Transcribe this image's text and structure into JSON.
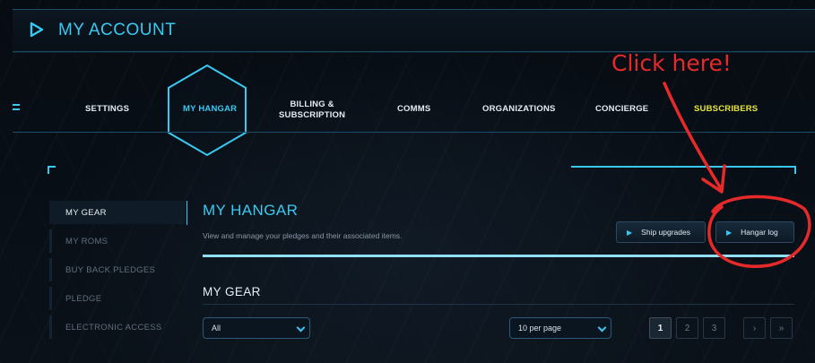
{
  "header": {
    "title": "MY ACCOUNT",
    "icon": "play-icon"
  },
  "nav": {
    "items": [
      {
        "label": "SETTINGS"
      },
      {
        "label": "MY HANGAR"
      },
      {
        "label_line1": "BILLING &",
        "label_line2": "SUBSCRIPTION"
      },
      {
        "label": "COMMS"
      },
      {
        "label": "ORGANIZATIONS"
      },
      {
        "label": "CONCIERGE"
      },
      {
        "label": "SUBSCRIBERS"
      }
    ]
  },
  "annotation": {
    "text": "Click here!"
  },
  "sidebar": {
    "items": [
      {
        "label": "MY GEAR"
      },
      {
        "label": "MY ROMS"
      },
      {
        "label": "BUY BACK PLEDGES"
      },
      {
        "label": "PLEDGE"
      },
      {
        "label": "ELECTRONIC ACCESS"
      }
    ]
  },
  "main": {
    "title": "MY HANGAR",
    "subtitle": "View and manage your pledges and their associated items.",
    "buttons": {
      "ship_upgrades": "Ship upgrades",
      "hangar_log": "Hangar log"
    },
    "gear_title": "MY GEAR",
    "filter": {
      "value": "All"
    },
    "per_page": {
      "value": "10 per page"
    },
    "pagination": {
      "pages": [
        "1",
        "2",
        "3"
      ],
      "next": "›",
      "last": "»"
    }
  },
  "colors": {
    "accent": "#39c9f0",
    "subscribers": "#e6e63a",
    "annotation": "#e62a2a",
    "background": "#060b12"
  }
}
